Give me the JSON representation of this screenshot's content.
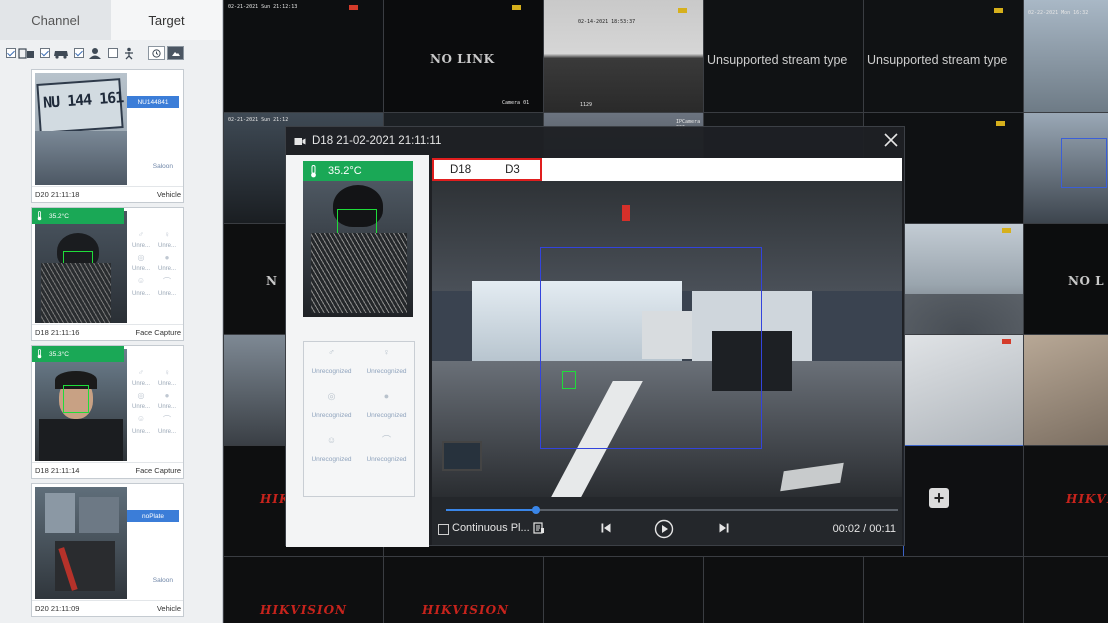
{
  "left_panel": {
    "tabs": [
      {
        "label": "Channel"
      },
      {
        "label": "Target"
      }
    ],
    "cards": [
      {
        "plate": "NU144841",
        "vehicle_type": "Saloon",
        "time": "D20 21:11:18",
        "kind": "Vehicle"
      },
      {
        "temperature": "35.2°C",
        "time": "D18 21:11:16",
        "kind": "Face Capture",
        "attrs": [
          "Unre...",
          "Unre...",
          "Unre...",
          "Unre...",
          "Unre...",
          "Unre..."
        ]
      },
      {
        "temperature": "35.3°C",
        "time": "D18 21:11:14",
        "kind": "Face Capture",
        "attrs": [
          "Unre...",
          "Unre...",
          "Unre...",
          "Unre...",
          "Unre...",
          "Unre..."
        ]
      },
      {
        "plate": "noPlate",
        "vehicle_type": "Saloon",
        "time": "D20 21:11:09",
        "kind": "Vehicle"
      }
    ]
  },
  "wall": {
    "osd": {
      "c1": "02-21-2021 Sun 21:12:13",
      "c3": "02-14-2021 18:53:37",
      "c3b": "1129",
      "c2b": "Camera 01",
      "c7": "02-22-2021 Mon 16:32",
      "r2a": "02-21-2021 Sun 21:12",
      "r2c": "IPCamera 326"
    },
    "no_link": "NO LINK",
    "no_link_short": "NO L",
    "no_link_n": "N",
    "unsupported": "Unsupported stream type",
    "brand": "HIKVISION",
    "brand_short": "HIKVI"
  },
  "popup": {
    "title": "D18 21-02-2021 21:11:11",
    "snap_temp": "35.2°C",
    "snap_attrs": [
      "Unrecognized",
      "Unrecognized",
      "Unrecognized",
      "Unrecognized",
      "Unrecognized",
      "Unrecognized"
    ],
    "video_tabs": [
      "D18",
      "D3"
    ],
    "continuous_label": "Continuous Pl...",
    "time": "00:02 / 00:11",
    "progress": 0.2
  },
  "colors": {
    "accent": "#3a86e8",
    "temp_green": "#1aa856",
    "highlight_red": "#e01e1e",
    "brand_red": "#c7231c"
  }
}
